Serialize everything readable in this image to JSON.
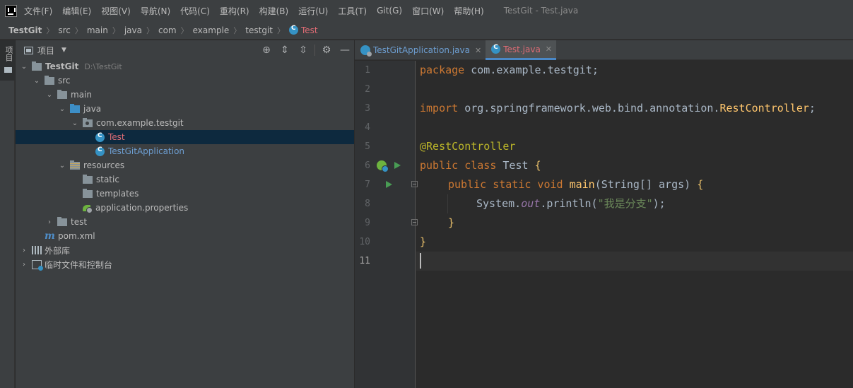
{
  "menubar": {
    "items": [
      "文件(F)",
      "编辑(E)",
      "视图(V)",
      "导航(N)",
      "代码(C)",
      "重构(R)",
      "构建(B)",
      "运行(U)",
      "工具(T)",
      "Git(G)",
      "窗口(W)",
      "帮助(H)"
    ],
    "window_title": "TestGit - Test.java"
  },
  "breadcrumb": {
    "items": [
      "TestGit",
      "src",
      "main",
      "java",
      "com",
      "example",
      "testgit"
    ],
    "active": "Test"
  },
  "left_stripe": {
    "label": "项目"
  },
  "project_panel": {
    "title": "项目",
    "tree": {
      "root_name": "TestGit",
      "root_path": "D:\\TestGit",
      "src": "src",
      "main": "main",
      "java": "java",
      "package": "com.example.testgit",
      "test_class": "Test",
      "app_class": "TestGitApplication",
      "resources": "resources",
      "static": "static",
      "templates": "templates",
      "app_props": "application.properties",
      "test_dir": "test",
      "pom": "pom.xml",
      "ext_libs": "外部库",
      "scratches": "临时文件和控制台"
    }
  },
  "editor_tabs": [
    {
      "label": "TestGitApplication.java",
      "active": false
    },
    {
      "label": "Test.java",
      "active": true
    }
  ],
  "editor": {
    "line_numbers": [
      "1",
      "2",
      "3",
      "4",
      "5",
      "6",
      "7",
      "8",
      "9",
      "10",
      "11"
    ],
    "current_line": 11,
    "code": {
      "l1_kw": "package",
      "l1_rest": " com.example.testgit;",
      "l3_kw": "import",
      "l3_rest": " org.springframework.web.bind.annotation.",
      "l3_cls": "RestController",
      "l3_end": ";",
      "l5_ann": "@RestController",
      "l6_kw": "public class",
      "l6_name": " Test ",
      "l6_brace": "{",
      "l7_kw": "public static void",
      "l7_fn": "main",
      "l7_args": "(String[] args) ",
      "l7_brace": "{",
      "l8_a": "System.",
      "l8_fld": "out",
      "l8_b": ".println(",
      "l8_str": "\"我是分支\"",
      "l8_c": ");",
      "l9": "}",
      "l10": "}"
    }
  }
}
